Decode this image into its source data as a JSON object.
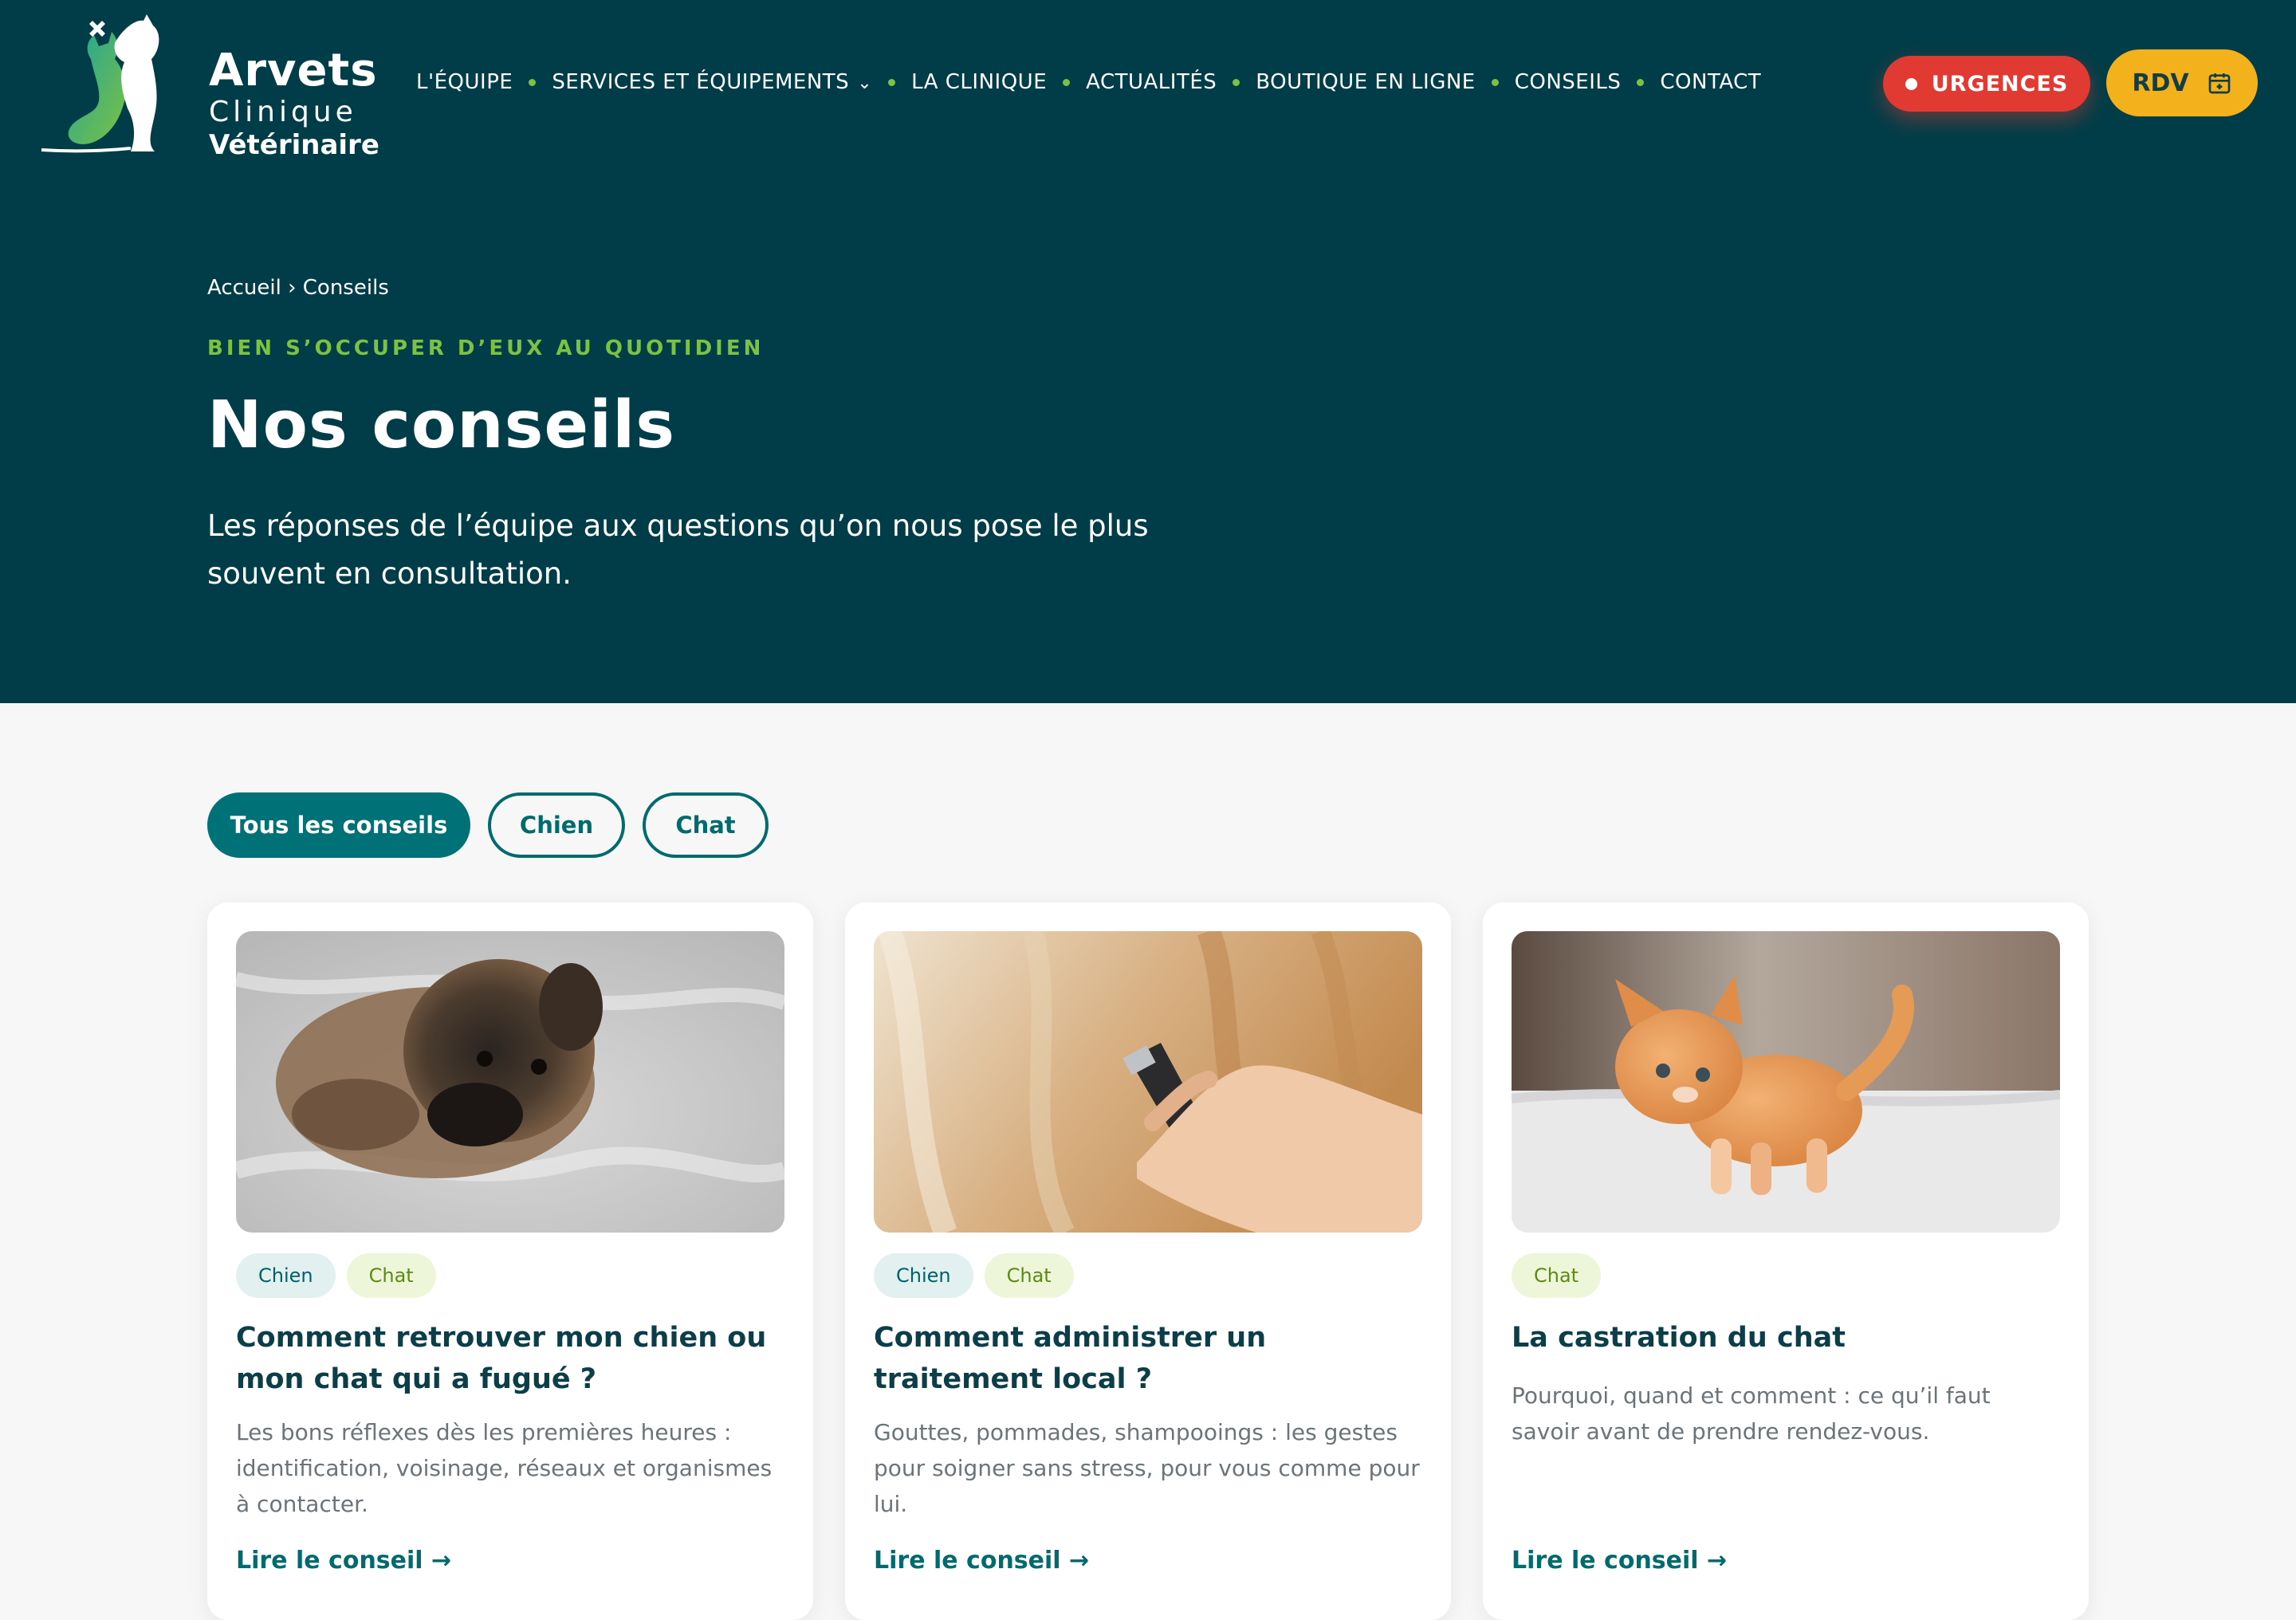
{
  "brand": {
    "name": "Arvets",
    "line1": "Clinique",
    "line2": "Vétérinaire"
  },
  "nav": {
    "items": [
      {
        "label": "L'ÉQUIPE"
      },
      {
        "label": "SERVICES ET ÉQUIPEMENTS"
      },
      {
        "label": "LA CLINIQUE"
      },
      {
        "label": "ACTUALITÉS"
      },
      {
        "label": "BOUTIQUE EN LIGNE"
      },
      {
        "label": "CONSEILS"
      },
      {
        "label": "CONTACT"
      }
    ],
    "urgences_label": "URGENCES",
    "rdv_label": "RDV"
  },
  "hero": {
    "breadcrumb": "Accueil › Conseils",
    "eyebrow": "BIEN S’OCCUPER D’EUX AU QUOTIDIEN",
    "title": "Nos conseils",
    "intro": "Les réponses de l’équipe aux questions qu’on nous pose le plus souvent en consultation."
  },
  "filters": [
    {
      "label": "Tous les conseils",
      "active": true
    },
    {
      "label": "Chien",
      "active": false
    },
    {
      "label": "Chat",
      "active": false
    }
  ],
  "cards": [
    {
      "image": "puppy-on-blanket",
      "tags": [
        "Chien",
        "Chat"
      ],
      "title": "Comment retrouver mon chien ou mon chat qui a fugué ?",
      "text": "Les bons réflexes dès les premières heures : identification, voisinage, réseaux et organismes à contacter.",
      "link": "Lire le conseil →"
    },
    {
      "image": "fur-being-clipped",
      "tags": [
        "Chien",
        "Chat"
      ],
      "title": "Comment administrer un traitement local ?",
      "text": "Gouttes, pommades, shampooings : les gestes pour soigner sans stress, pour vous comme pour lui.",
      "link": "Lire le conseil →"
    },
    {
      "image": "ginger-kitten",
      "tags": [
        "Chat"
      ],
      "title": "La castration du chat",
      "text": "Pourquoi, quand et comment : ce qu’il faut savoir avant de prendre rendez-vous.",
      "link": "Lire le conseil →"
    }
  ],
  "colors": {
    "header_bg": "#003d48",
    "accent_green": "#7cc242",
    "urgences_red": "#e03a33",
    "rdv_yellow": "#f3b21b",
    "teal": "#007177"
  }
}
